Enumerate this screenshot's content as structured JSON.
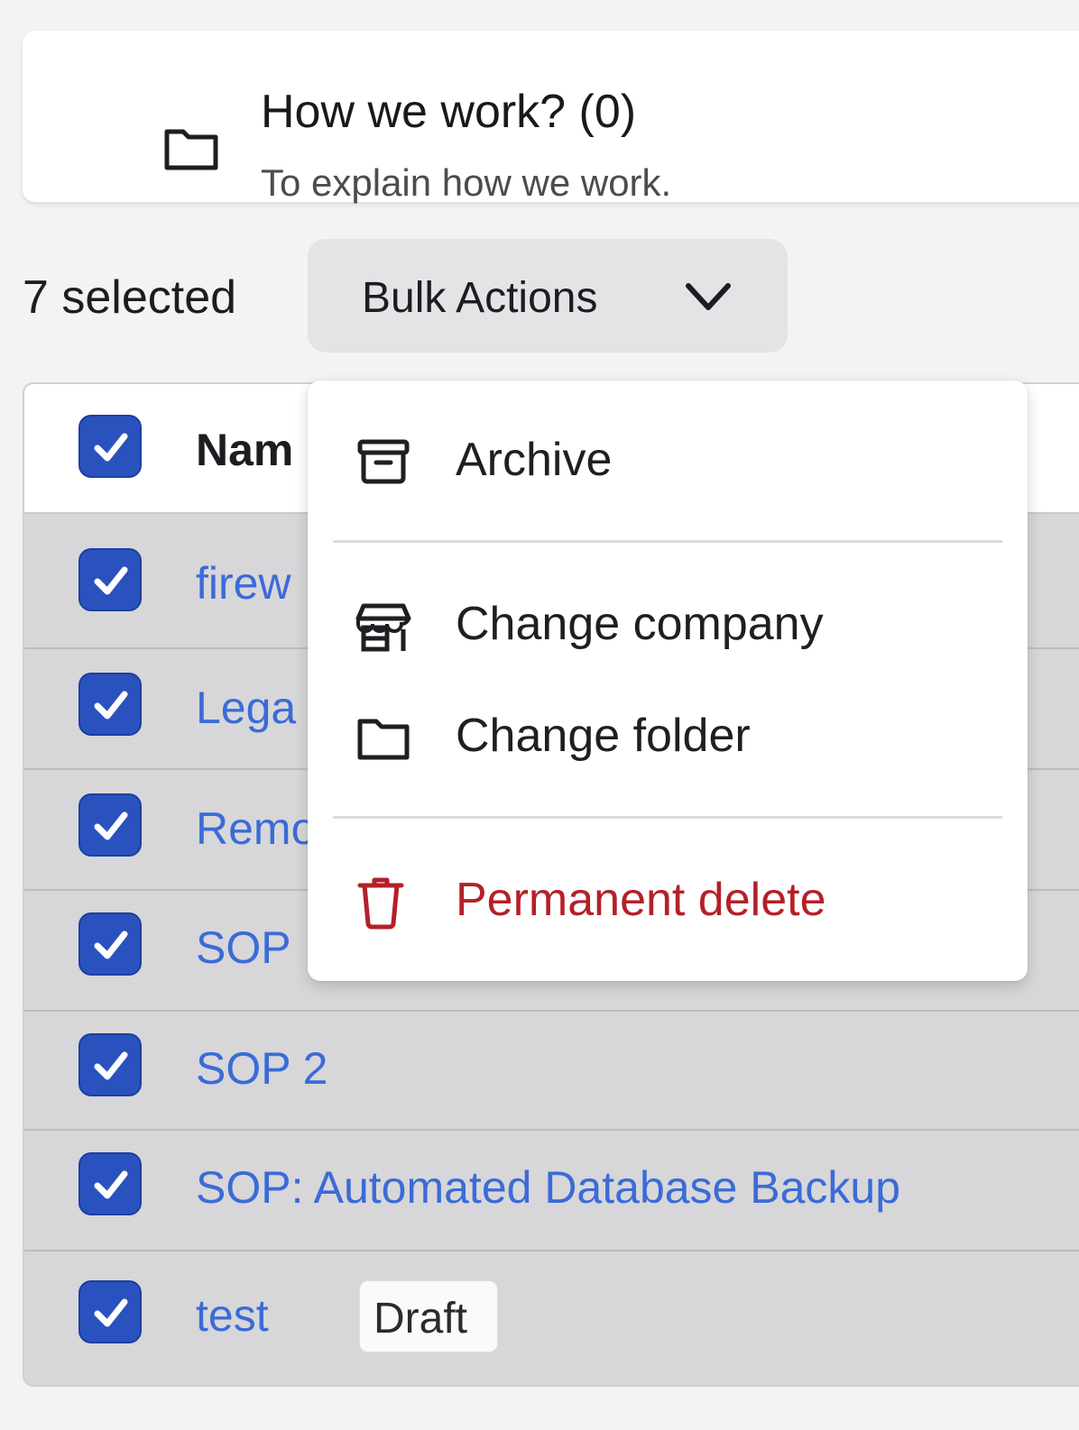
{
  "folder": {
    "title": "How we work? (0)",
    "description": "To explain how we work.",
    "icon": "folder-icon"
  },
  "bulk_bar": {
    "selected_count": "7 selected",
    "bulk_actions_label": "Bulk Actions"
  },
  "table": {
    "header": {
      "name": "Nam",
      "checked": true
    },
    "rows": [
      {
        "name": "firew",
        "checked": true
      },
      {
        "name": "Lega",
        "checked": true
      },
      {
        "name": "Remo",
        "checked": true
      },
      {
        "name": "SOP",
        "checked": true
      },
      {
        "name": "SOP 2",
        "checked": true
      },
      {
        "name": "SOP: Automated Database Backup",
        "checked": true
      },
      {
        "name": "test",
        "checked": true,
        "badge": "Draft"
      }
    ]
  },
  "dropdown": {
    "items": [
      {
        "label": "Archive",
        "icon": "archive-icon"
      },
      {
        "label": "Change company",
        "icon": "store-icon"
      },
      {
        "label": "Change folder",
        "icon": "folder-icon"
      },
      {
        "label": "Permanent delete",
        "icon": "trash-icon",
        "danger": true
      }
    ]
  },
  "colors": {
    "accent": "#2a52be",
    "link": "#3b6bd8",
    "danger": "#b42029"
  }
}
